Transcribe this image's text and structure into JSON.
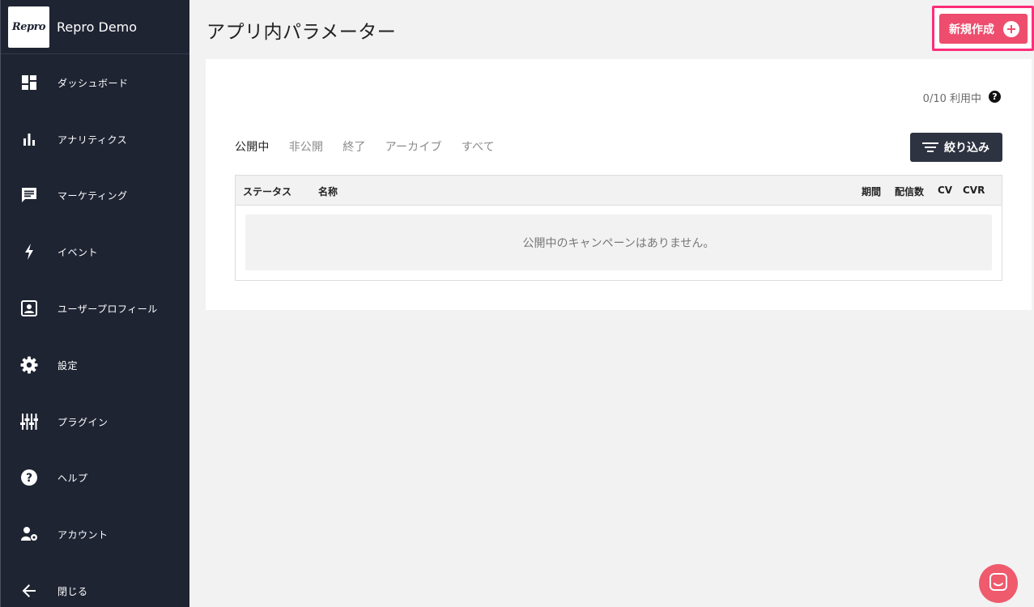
{
  "brand": {
    "logo_text": "Repro",
    "app_name": "Repro Demo"
  },
  "sidebar": {
    "items": [
      {
        "label": "ダッシュボード",
        "icon": "dashboard-icon"
      },
      {
        "label": "アナリティクス",
        "icon": "bar-chart-icon"
      },
      {
        "label": "マーケティング",
        "icon": "chat-icon"
      },
      {
        "label": "イベント",
        "icon": "bolt-icon"
      },
      {
        "label": "ユーザープロフィール",
        "icon": "profile-icon"
      },
      {
        "label": "設定",
        "icon": "gear-icon"
      },
      {
        "label": "プラグイン",
        "icon": "sliders-icon"
      },
      {
        "label": "ヘルプ",
        "icon": "help-icon"
      },
      {
        "label": "アカウント",
        "icon": "account-settings-icon"
      },
      {
        "label": "閉じる",
        "icon": "arrow-left-icon"
      }
    ]
  },
  "header": {
    "title": "アプリ内パラメーター",
    "create_label": "新規作成"
  },
  "card": {
    "usage": "0/10 利用中",
    "help_glyph": "?",
    "tabs": [
      "公開中",
      "非公開",
      "終了",
      "アーカイブ",
      "すべて"
    ],
    "active_tab": "公開中",
    "filter_label": "絞り込み",
    "table": {
      "columns": [
        "ステータス",
        "名称",
        "期間",
        "配信数",
        "CV",
        "CVR"
      ],
      "empty_message": "公開中のキャンペーンはありません。"
    }
  },
  "colors": {
    "sidebar_bg": "#1f2433",
    "accent": "#ee4d6e",
    "highlight": "#ff2d7a",
    "filter_bg": "#2e3341",
    "chat_bg": "#ef5a6d"
  }
}
